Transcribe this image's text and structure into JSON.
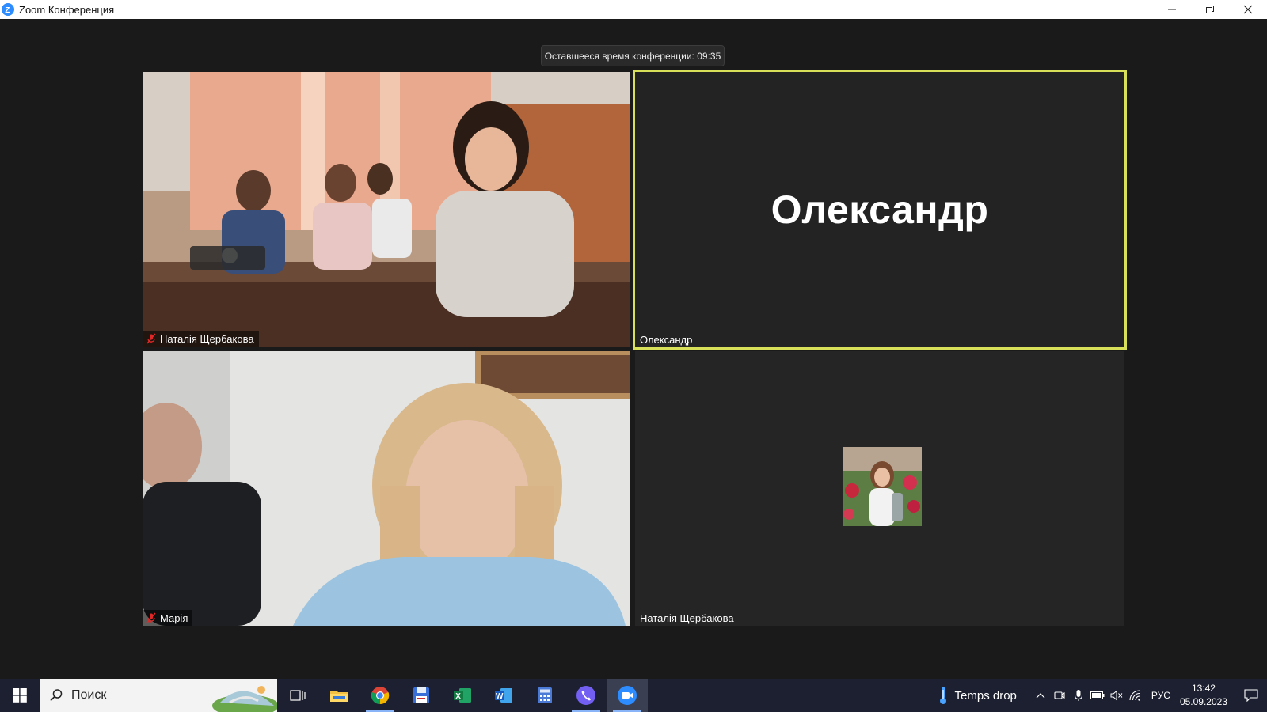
{
  "window": {
    "title": "Zoom Конференция",
    "controls": [
      "minimize",
      "restore",
      "close"
    ]
  },
  "meeting": {
    "timer_text": "Оставшееся время конференции: 09:35"
  },
  "tiles": [
    {
      "name": "Наталія Щербакова",
      "muted": true,
      "type": "video"
    },
    {
      "name": "Олександр",
      "display_name": "Олександр",
      "muted": false,
      "type": "name-only",
      "speaking": true
    },
    {
      "name": "Марія",
      "muted": true,
      "type": "video"
    },
    {
      "name": "Наталія Щербакова",
      "muted": false,
      "type": "avatar"
    }
  ],
  "taskbar": {
    "search_placeholder": "Поиск",
    "apps": [
      "task-view",
      "file-explorer",
      "chrome",
      "save-disk",
      "excel",
      "word",
      "calculator",
      "viber",
      "zoom"
    ],
    "weather_text": "Temps drop",
    "language": "РУС",
    "time": "13:42",
    "date": "05.09.2023"
  },
  "colors": {
    "active_speaker_border": "#d8e05a",
    "zoom_blue": "#2d8cff",
    "mute_red": "#e02828",
    "taskbar": "#1c2030"
  }
}
